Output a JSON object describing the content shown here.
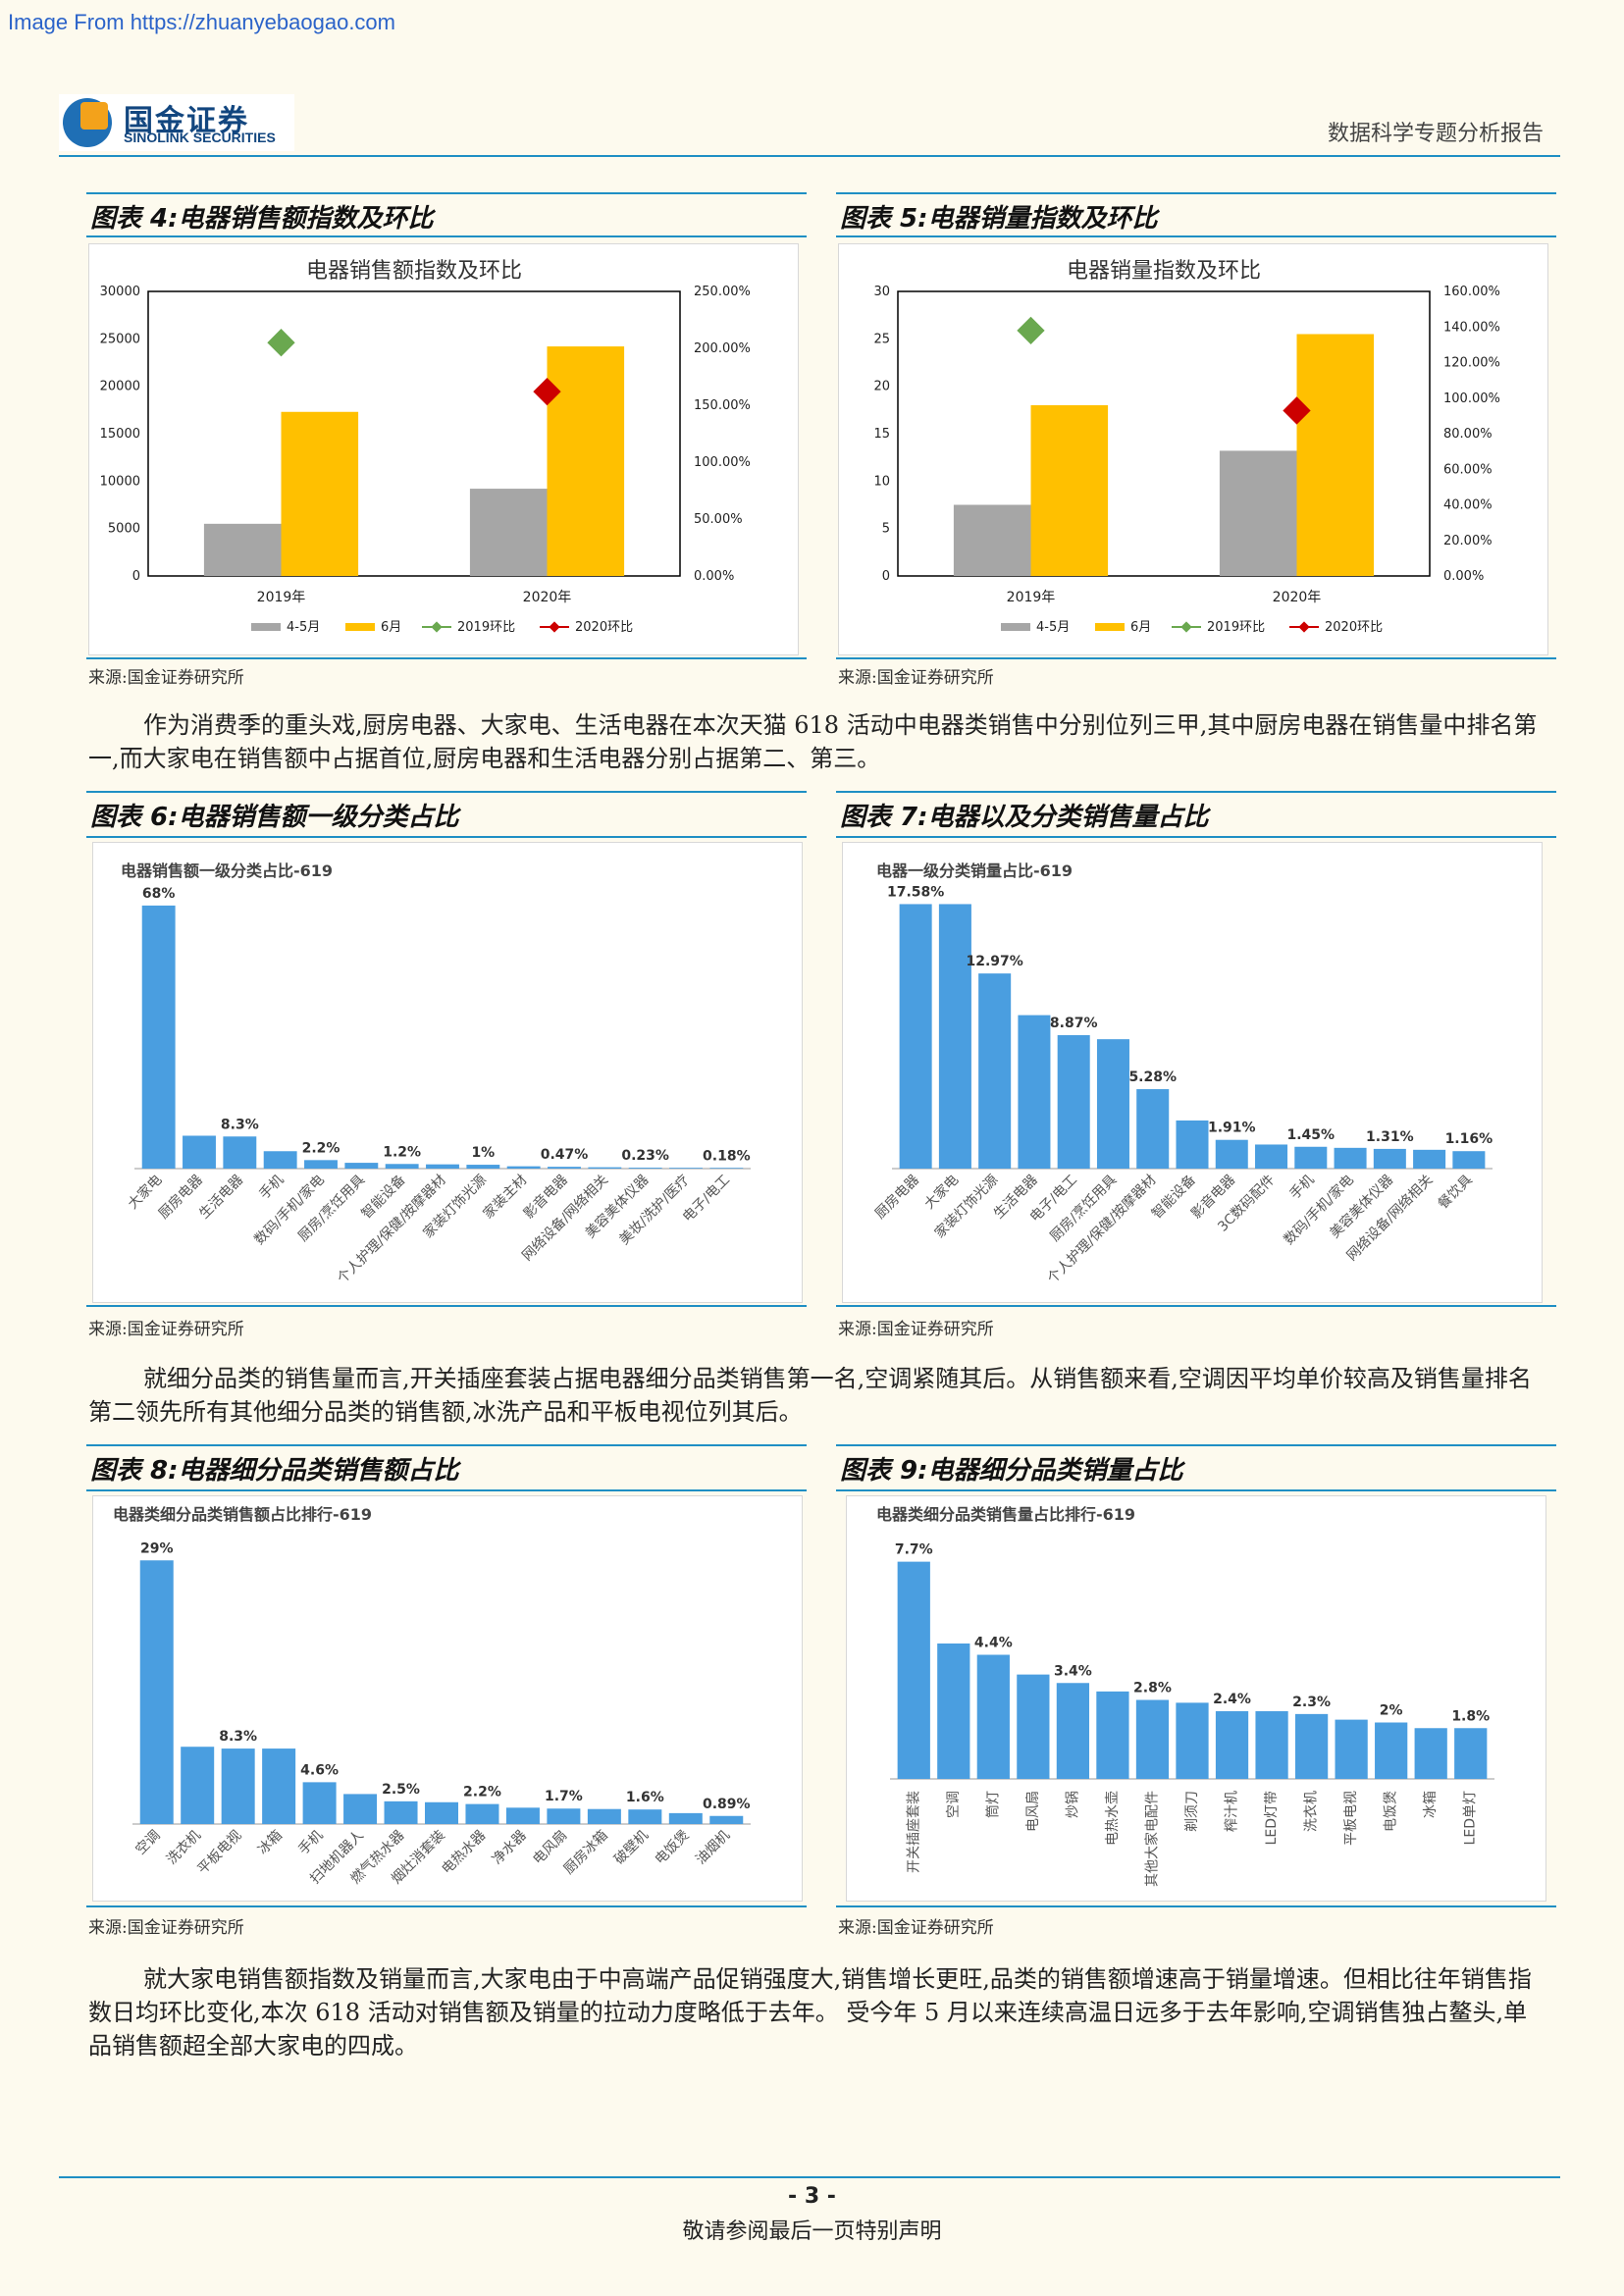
{
  "watermark": "Image From https://zhuanyebaogao.com",
  "header": {
    "logo_cn": "国金证券",
    "logo_en": "SINOLINK SECURITIES",
    "report_title": "数据科学专题分析报告"
  },
  "figures": {
    "fig4": {
      "title": "图表 4:电器销售额指数及环比",
      "source": "来源:国金证券研究所"
    },
    "fig5": {
      "title": "图表 5:电器销量指数及环比",
      "source": "来源:国金证券研究所"
    },
    "fig6": {
      "title": "图表 6:电器销售额一级分类占比",
      "source": "来源:国金证券研究所"
    },
    "fig7": {
      "title": "图表 7:电器以及分类销售量占比",
      "source": "来源:国金证券研究所"
    },
    "fig8": {
      "title": "图表 8:电器细分品类销售额占比",
      "source": "来源:国金证券研究所"
    },
    "fig9": {
      "title": "图表 9:电器细分品类销量占比",
      "source": "来源:国金证券研究所"
    }
  },
  "paragraphs": {
    "p1": "作为消费季的重头戏,厨房电器、大家电、生活电器在本次天猫 618 活动中电器类销售中分别位列三甲,其中厨房电器在销售量中排名第一,而大家电在销售额中占据首位,厨房电器和生活电器分别占据第二、第三。",
    "p2": "就细分品类的销售量而言,开关插座套装占据电器细分品类销售第一名,空调紧随其后。从销售额来看,空调因平均单价较高及销售量排名第二领先所有其他细分品类的销售额,冰洗产品和平板电视位列其后。",
    "p3": "就大家电销售额指数及销量而言,大家电由于中高端产品促销强度大,销售增长更旺,品类的销售额增速高于销量增速。但相比往年销售指数日均环比变化,本次 618 活动对销售额及销量的拉动力度略低于去年。 受今年 5 月以来连续高温日远多于去年影响,空调销售独占鳌头,单品销售额超全部大家电的四成。"
  },
  "footer": {
    "page": "- 3 -",
    "note": "敬请参阅最后一页特别声明"
  },
  "chart_data": [
    {
      "id": "fig4",
      "type": "bar",
      "title": "电器销售额指数及环比",
      "categories": [
        "2019年",
        "2020年"
      ],
      "series": [
        {
          "name": "4-5月",
          "values": [
            5500,
            9200
          ],
          "color": "#a6a6a6"
        },
        {
          "name": "6月",
          "values": [
            17300,
            24200
          ],
          "color": "#ffc000"
        }
      ],
      "markers": [
        {
          "name": "2019环比",
          "category": "2019年",
          "value": 2.05,
          "color": "#6aa84f"
        },
        {
          "name": "2020环比",
          "category": "2020年",
          "value": 1.62,
          "color": "#cc0000"
        }
      ],
      "ylim": [
        0,
        30000
      ],
      "yticks": [
        "0",
        "5000",
        "10000",
        "15000",
        "20000",
        "25000",
        "30000"
      ],
      "y2lim": [
        0,
        2.5
      ],
      "y2ticks": [
        "0.00%",
        "50.00%",
        "100.00%",
        "150.00%",
        "200.00%",
        "250.00%"
      ],
      "legend": "bottom"
    },
    {
      "id": "fig5",
      "type": "bar",
      "title": "电器销量指数及环比",
      "categories": [
        "2019年",
        "2020年"
      ],
      "series": [
        {
          "name": "4-5月",
          "values": [
            7.5,
            13.2
          ],
          "color": "#a6a6a6"
        },
        {
          "name": "6月",
          "values": [
            18,
            25.5
          ],
          "color": "#ffc000"
        }
      ],
      "markers": [
        {
          "name": "2019环比",
          "category": "2019年",
          "value": 1.38,
          "color": "#6aa84f"
        },
        {
          "name": "2020环比",
          "category": "2020年",
          "value": 0.93,
          "color": "#cc0000"
        }
      ],
      "ylim": [
        0,
        30
      ],
      "yticks": [
        "0",
        "5",
        "10",
        "15",
        "20",
        "25",
        "30"
      ],
      "y2lim": [
        0,
        1.6
      ],
      "y2ticks": [
        "0.00%",
        "20.00%",
        "40.00%",
        "60.00%",
        "80.00%",
        "100.00%",
        "120.00%",
        "140.00%",
        "160.00%"
      ],
      "legend": "bottom"
    },
    {
      "id": "fig6",
      "type": "bar",
      "title": "电器销售额一级分类占比-619",
      "categories": [
        "大家电",
        "厨房电器",
        "生活电器",
        "手机",
        "数码/手机/家电",
        "厨房/烹饪用具",
        "智能设备",
        "个人护理/保健/按摩器材",
        "家装灯饰光源",
        "家装主材",
        "影音电器",
        "网络设备/网络相关",
        "美容美体仪器",
        "美妆/洗护/医疗",
        "电子/电工"
      ],
      "values": [
        68,
        8.5,
        8.3,
        4.5,
        2.2,
        1.5,
        1.2,
        1.1,
        1,
        0.6,
        0.47,
        0.35,
        0.23,
        0.2,
        0.18
      ],
      "labels": {
        "0": "68%",
        "2": "8.3%",
        "4": "2.2%",
        "6": "1.2%",
        "8": "1%",
        "10": "0.47%",
        "12": "0.23%",
        "14": "0.18%"
      },
      "ylim": [
        0,
        70
      ]
    },
    {
      "id": "fig7",
      "type": "bar",
      "title": "电器一级分类销量占比-619",
      "categories": [
        "厨房电器",
        "大家电",
        "家装灯饰光源",
        "生活电器",
        "电子/电工",
        "厨房/烹饪用具",
        "个人护理/保健/按摩器材",
        "智能设备",
        "影音电器",
        "3C数码配件",
        "手机",
        "数码/手机/家电",
        "美容美体仪器",
        "网络设备/网络相关",
        "餐饮具"
      ],
      "values": [
        17.58,
        17.58,
        12.97,
        10.2,
        8.87,
        8.6,
        5.28,
        3.2,
        1.91,
        1.6,
        1.45,
        1.38,
        1.31,
        1.25,
        1.16
      ],
      "labels": {
        "0": "17.58%",
        "2": "12.97%",
        "4": "8.87%",
        "6": "5.28%",
        "8": "1.91%",
        "10": "1.45%",
        "12": "1.31%",
        "14": "1.16%"
      },
      "ylim": [
        0,
        18
      ]
    },
    {
      "id": "fig8",
      "type": "bar",
      "title": "电器类细分品类销售额占比排行-619",
      "categories": [
        "空调",
        "洗衣机",
        "平板电视",
        "冰箱",
        "手机",
        "扫地机器人",
        "燃气热水器",
        "烟灶消套装",
        "电热水器",
        "净水器",
        "电风扇",
        "厨房冰箱",
        "破壁机",
        "电饭煲",
        "油烟机"
      ],
      "values": [
        29,
        8.5,
        8.3,
        8.3,
        4.6,
        3.3,
        2.5,
        2.4,
        2.2,
        1.8,
        1.7,
        1.65,
        1.6,
        1.2,
        0.89
      ],
      "labels": {
        "0": "29%",
        "2": "8.3%",
        "4": "4.6%",
        "6": "2.5%",
        "8": "2.2%",
        "10": "1.7%",
        "12": "1.6%",
        "14": "0.89%"
      },
      "ylim": [
        0,
        30
      ]
    },
    {
      "id": "fig9",
      "type": "bar",
      "title": "电器类细分品类销售量占比排行-619",
      "categories": [
        "开关插座套装",
        "空调",
        "筒灯",
        "电风扇",
        "炒锅",
        "电热水壶",
        "其他大家电配件",
        "剃须刀",
        "榨汁机",
        "LED灯带",
        "洗衣机",
        "平板电视",
        "电饭煲",
        "冰箱",
        "LED单灯"
      ],
      "values": [
        7.7,
        4.8,
        4.4,
        3.7,
        3.4,
        3.1,
        2.8,
        2.7,
        2.4,
        2.4,
        2.3,
        2.1,
        2,
        1.8,
        1.8
      ],
      "labels": {
        "0": "7.7%",
        "2": "4.4%",
        "4": "3.4%",
        "6": "2.8%",
        "8": "2.4%",
        "10": "2.3%",
        "12": "2%",
        "14": "1.8%"
      },
      "ylim": [
        0,
        8
      ]
    }
  ]
}
